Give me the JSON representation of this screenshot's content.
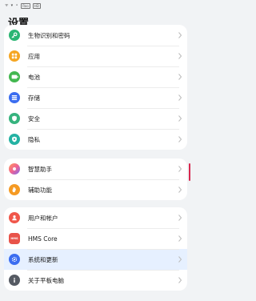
{
  "title": "设置",
  "status_bar": {
    "texts": [
      "ᯤ",
      "▾",
      "⚬",
      "Roo",
      "HD"
    ]
  },
  "groups": [
    {
      "items": [
        {
          "label": "生物识别和密码",
          "icon": "key-icon",
          "color": "#2bb573"
        },
        {
          "label": "应用",
          "icon": "apps-icon",
          "color": "#f5a623"
        },
        {
          "label": "电池",
          "icon": "battery-icon",
          "color": "#43b750"
        },
        {
          "label": "存储",
          "icon": "storage-icon",
          "color": "#3b6df0"
        },
        {
          "label": "安全",
          "icon": "shield-icon",
          "color": "#36b37e"
        },
        {
          "label": "隐私",
          "icon": "privacy-icon",
          "color": "#24b2a3"
        }
      ]
    },
    {
      "items": [
        {
          "label": "智慧助手",
          "icon": "assistant-icon",
          "color": "#f77b8b"
        },
        {
          "label": "辅助功能",
          "icon": "hand-icon",
          "color": "#f59a23"
        }
      ]
    },
    {
      "items": [
        {
          "label": "用户和帐户",
          "icon": "user-icon",
          "color": "#f0564a"
        },
        {
          "label": "HMS Core",
          "icon": "hms-core-icon",
          "color": "#e8534a",
          "icon_text": "HMS"
        },
        {
          "label": "系统和更新",
          "icon": "system-update-icon",
          "color": "#3b6df0",
          "selected": true
        },
        {
          "label": "关于平板电脑",
          "icon": "info-icon",
          "color": "#555a63"
        }
      ]
    }
  ]
}
